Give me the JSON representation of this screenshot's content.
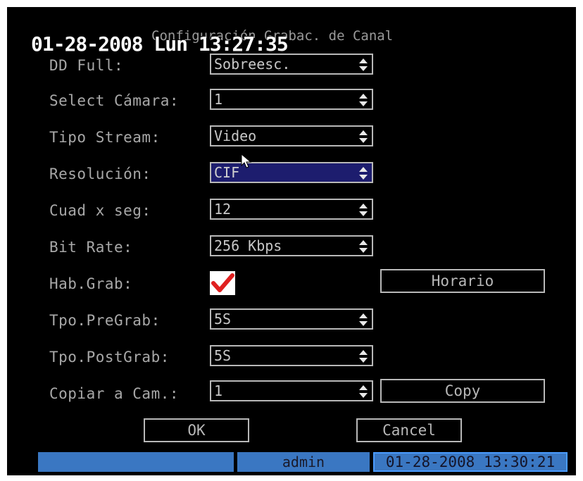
{
  "osd": {
    "datetime": "01-28-2008 Lun 13:27:35"
  },
  "dialog": {
    "title": "Configuración Grabac. de Canal",
    "rows": [
      {
        "label": "DD Full:",
        "value": "Sobreesc."
      },
      {
        "label": "Select Cámara:",
        "value": "1"
      },
      {
        "label": "Tipo Stream:",
        "value": "Video"
      },
      {
        "label": "Resolución:",
        "value": "CIF"
      },
      {
        "label": "Cuad x seg:",
        "value": "12"
      },
      {
        "label": "Bit Rate:",
        "value": "256 Kbps"
      },
      {
        "label": "Hab.Grab:",
        "value": ""
      },
      {
        "label": "Tpo.PreGrab:",
        "value": "5S"
      },
      {
        "label": "Tpo.PostGrab:",
        "value": "5S"
      },
      {
        "label": "Copiar a Cam.:",
        "value": "1"
      }
    ],
    "hab_grab_checked": true,
    "horario_label": "Horario",
    "copy_label": "Copy",
    "ok_label": "OK",
    "cancel_label": "Cancel"
  },
  "statusbar": {
    "user": "admin",
    "datetime": "01-28-2008 13:30:21"
  },
  "colors": {
    "statusbar": "#3a77c2",
    "selected_field": "#1d1d6e",
    "check": "#e02020"
  }
}
